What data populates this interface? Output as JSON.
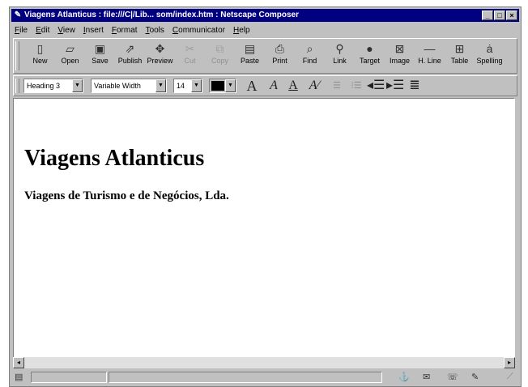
{
  "window": {
    "title": "Viagens Atlanticus : file:///C|/Lib... som/index.htm : Netscape Composer",
    "buttons": {
      "minimize": "_",
      "maximize": "□",
      "close": "×"
    }
  },
  "menu": [
    "File",
    "Edit",
    "View",
    "Insert",
    "Format",
    "Tools",
    "Communicator",
    "Help"
  ],
  "toolbar": [
    {
      "label": "New",
      "icon": "new-doc-icon",
      "glyph": "▯",
      "enabled": true
    },
    {
      "label": "Open",
      "icon": "open-folder-icon",
      "glyph": "▱",
      "enabled": true
    },
    {
      "label": "Save",
      "icon": "floppy-disk-icon",
      "glyph": "▣",
      "enabled": true
    },
    {
      "label": "Publish",
      "icon": "publish-icon",
      "glyph": "⇗",
      "enabled": true
    },
    {
      "label": "Preview",
      "icon": "preview-icon",
      "glyph": "✥",
      "enabled": true
    },
    {
      "label": "Cut",
      "icon": "scissors-icon",
      "glyph": "✂",
      "enabled": false
    },
    {
      "label": "Copy",
      "icon": "copy-icon",
      "glyph": "⧉",
      "enabled": false
    },
    {
      "label": "Paste",
      "icon": "paste-icon",
      "glyph": "▤",
      "enabled": true
    },
    {
      "label": "Print",
      "icon": "printer-icon",
      "glyph": "⎙",
      "enabled": true
    },
    {
      "label": "Find",
      "icon": "find-icon",
      "glyph": "⌕",
      "enabled": true
    },
    {
      "label": "Link",
      "icon": "link-icon",
      "glyph": "⚲",
      "enabled": true
    },
    {
      "label": "Target",
      "icon": "target-icon",
      "glyph": "●",
      "enabled": true
    },
    {
      "label": "Image",
      "icon": "image-icon",
      "glyph": "⊠",
      "enabled": true
    },
    {
      "label": "H. Line",
      "icon": "horizontal-line-icon",
      "glyph": "—",
      "enabled": true
    },
    {
      "label": "Table",
      "icon": "table-icon",
      "glyph": "⊞",
      "enabled": true
    },
    {
      "label": "Spelling",
      "icon": "spelling-icon",
      "glyph": "ȧ",
      "enabled": true
    }
  ],
  "format": {
    "paragraph_style": "Heading 3",
    "font": "Variable Width",
    "font_size": "14",
    "text_color": "#000000",
    "dropdown_arrow": "▼",
    "buttons": [
      {
        "name": "font-size-decrease-button",
        "glyph": "A",
        "dim": false,
        "style": "normal"
      },
      {
        "name": "font-size-increase-button",
        "glyph": "A",
        "dim": false,
        "style": "italic"
      },
      {
        "name": "bold-button",
        "glyph": "A",
        "dim": false,
        "style": "underline"
      },
      {
        "name": "clear-styles-button",
        "glyph": "A⁄",
        "dim": false,
        "style": "italic"
      },
      {
        "name": "bullet-list-button",
        "glyph": "☰",
        "dim": true
      },
      {
        "name": "numbered-list-button",
        "glyph": "⁝☰",
        "dim": true
      },
      {
        "name": "decrease-indent-button",
        "glyph": "◂☰",
        "dim": false
      },
      {
        "name": "increase-indent-button",
        "glyph": "▸☰",
        "dim": false
      },
      {
        "name": "alignment-button",
        "glyph": "≣",
        "dim": false
      }
    ]
  },
  "document": {
    "heading": "Viagens Atlanticus",
    "subheading": "Viagens de Turismo e de Negócios, Lda."
  },
  "scrollbar": {
    "left_arrow": "◂",
    "right_arrow": "▸"
  },
  "statusbar": {
    "icons": [
      "document-info-icon",
      "component-bar-icons"
    ]
  }
}
